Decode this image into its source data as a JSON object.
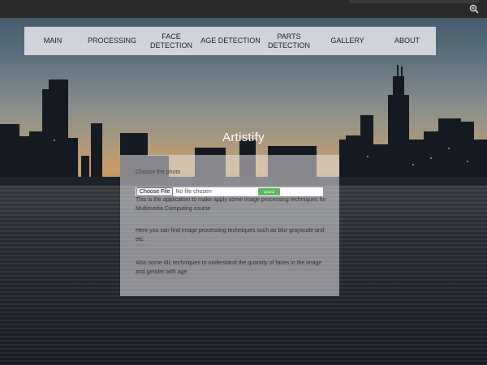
{
  "toolbar": {
    "zoom_icon": "zoom-icon"
  },
  "nav": {
    "items": [
      {
        "label": "MAIN"
      },
      {
        "label": "PROCESSING"
      },
      {
        "label": "FACE DETECTION"
      },
      {
        "label": "AGE DETECTION"
      },
      {
        "label_line1": "PARTS",
        "label_line2": "DETECTION"
      },
      {
        "label": "GALLERY"
      },
      {
        "label": "ABOUT"
      }
    ]
  },
  "hero": {
    "title": "Artistify"
  },
  "upload": {
    "choose_label": "Choose the photo",
    "file_button": "Choose File",
    "file_status": "No file chosen",
    "upload_button": "upload"
  },
  "content": {
    "paragraph1": "This is the application to make apply some image processing techniques for Multimedia Computing course",
    "paragraph2": "Here you can find image processing techniques such as blur grayscale and etc.",
    "paragraph3": "Also some ML techniques to understand the quantity of faces in the image and gender with age"
  },
  "colors": {
    "upload_button": "#5cb85c",
    "nav_background": "#ececf0"
  }
}
